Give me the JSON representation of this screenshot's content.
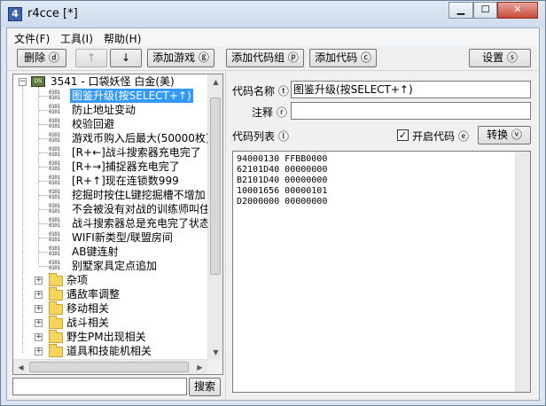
{
  "window": {
    "title": "r4cce [*]",
    "icon": "app-icon"
  },
  "menu": [
    "文件(F)",
    "工具(I)",
    "帮助(H)"
  ],
  "toolbar": {
    "delete": "删除 ⓓ",
    "up": "↑",
    "down": "↓",
    "add_game": "添加游戏 ⓖ",
    "add_group": "添加代码组 ⓟ",
    "add_code": "添加代码 ⓒ",
    "settings": "设置 ⓢ"
  },
  "tree": {
    "root_label": "3541 - 口袋妖怪 白金(美)",
    "codes": [
      "图鉴升级(按SELECT+↑)",
      "防止地址变动",
      "校验回避",
      "游戏币购入后最大(50000枚)",
      "[R+←]战斗搜索器充电完了",
      "[R+→]捕捉器充电完了",
      "[R+↑]现在连锁数999",
      "挖掘时按住L键挖掘槽不增加",
      "不会被没有对战的训练师叫住",
      "战斗搜索器总是充电完了状态",
      "WIFI新类型/联盟房间",
      "AB键连射",
      "别墅家具定点追加"
    ],
    "folders": [
      "杂项",
      "遇敌率调整",
      "移动相关",
      "战斗相关",
      "野生PM出现相关",
      "道具和技能机相关"
    ],
    "selected_index": 0
  },
  "search": {
    "value": "",
    "button": "搜索"
  },
  "detail": {
    "name_label": "代码名称 ⓣ",
    "name_value": "图鉴升级(按SELECT+↑)",
    "note_label": "注释 ⓡ",
    "note_value": "",
    "list_label": "代码列表 ⓛ",
    "enable_label": "开启代码 ⓔ",
    "enable_checked": true,
    "convert_button": "转换 ⓥ",
    "code_lines": [
      "94000130 FFBB0000",
      "62101D40 00000000",
      "B2101D40 00000000",
      "10001656 00000101",
      "D2000000 00000000"
    ]
  }
}
